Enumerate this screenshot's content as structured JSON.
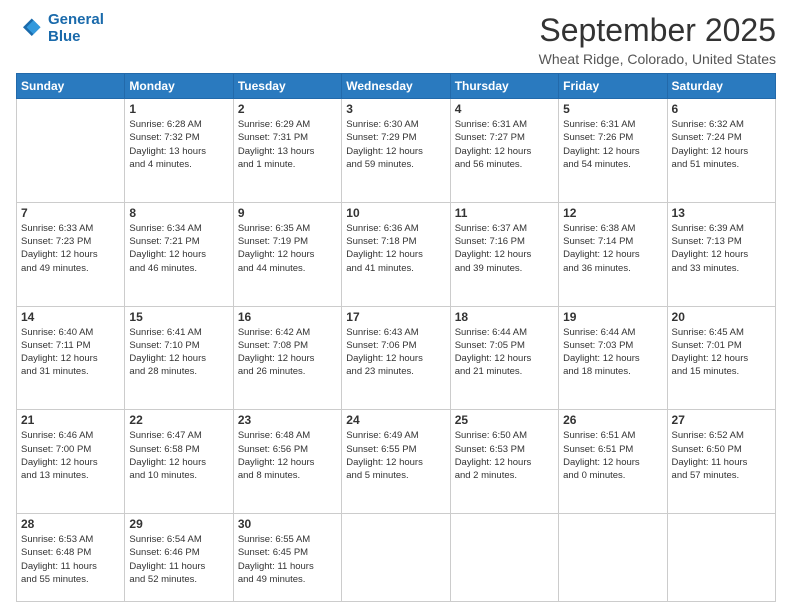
{
  "header": {
    "logo_line1": "General",
    "logo_line2": "Blue",
    "month_title": "September 2025",
    "location": "Wheat Ridge, Colorado, United States"
  },
  "days_of_week": [
    "Sunday",
    "Monday",
    "Tuesday",
    "Wednesday",
    "Thursday",
    "Friday",
    "Saturday"
  ],
  "weeks": [
    [
      {
        "day": "",
        "info": ""
      },
      {
        "day": "1",
        "info": "Sunrise: 6:28 AM\nSunset: 7:32 PM\nDaylight: 13 hours\nand 4 minutes."
      },
      {
        "day": "2",
        "info": "Sunrise: 6:29 AM\nSunset: 7:31 PM\nDaylight: 13 hours\nand 1 minute."
      },
      {
        "day": "3",
        "info": "Sunrise: 6:30 AM\nSunset: 7:29 PM\nDaylight: 12 hours\nand 59 minutes."
      },
      {
        "day": "4",
        "info": "Sunrise: 6:31 AM\nSunset: 7:27 PM\nDaylight: 12 hours\nand 56 minutes."
      },
      {
        "day": "5",
        "info": "Sunrise: 6:31 AM\nSunset: 7:26 PM\nDaylight: 12 hours\nand 54 minutes."
      },
      {
        "day": "6",
        "info": "Sunrise: 6:32 AM\nSunset: 7:24 PM\nDaylight: 12 hours\nand 51 minutes."
      }
    ],
    [
      {
        "day": "7",
        "info": "Sunrise: 6:33 AM\nSunset: 7:23 PM\nDaylight: 12 hours\nand 49 minutes."
      },
      {
        "day": "8",
        "info": "Sunrise: 6:34 AM\nSunset: 7:21 PM\nDaylight: 12 hours\nand 46 minutes."
      },
      {
        "day": "9",
        "info": "Sunrise: 6:35 AM\nSunset: 7:19 PM\nDaylight: 12 hours\nand 44 minutes."
      },
      {
        "day": "10",
        "info": "Sunrise: 6:36 AM\nSunset: 7:18 PM\nDaylight: 12 hours\nand 41 minutes."
      },
      {
        "day": "11",
        "info": "Sunrise: 6:37 AM\nSunset: 7:16 PM\nDaylight: 12 hours\nand 39 minutes."
      },
      {
        "day": "12",
        "info": "Sunrise: 6:38 AM\nSunset: 7:14 PM\nDaylight: 12 hours\nand 36 minutes."
      },
      {
        "day": "13",
        "info": "Sunrise: 6:39 AM\nSunset: 7:13 PM\nDaylight: 12 hours\nand 33 minutes."
      }
    ],
    [
      {
        "day": "14",
        "info": "Sunrise: 6:40 AM\nSunset: 7:11 PM\nDaylight: 12 hours\nand 31 minutes."
      },
      {
        "day": "15",
        "info": "Sunrise: 6:41 AM\nSunset: 7:10 PM\nDaylight: 12 hours\nand 28 minutes."
      },
      {
        "day": "16",
        "info": "Sunrise: 6:42 AM\nSunset: 7:08 PM\nDaylight: 12 hours\nand 26 minutes."
      },
      {
        "day": "17",
        "info": "Sunrise: 6:43 AM\nSunset: 7:06 PM\nDaylight: 12 hours\nand 23 minutes."
      },
      {
        "day": "18",
        "info": "Sunrise: 6:44 AM\nSunset: 7:05 PM\nDaylight: 12 hours\nand 21 minutes."
      },
      {
        "day": "19",
        "info": "Sunrise: 6:44 AM\nSunset: 7:03 PM\nDaylight: 12 hours\nand 18 minutes."
      },
      {
        "day": "20",
        "info": "Sunrise: 6:45 AM\nSunset: 7:01 PM\nDaylight: 12 hours\nand 15 minutes."
      }
    ],
    [
      {
        "day": "21",
        "info": "Sunrise: 6:46 AM\nSunset: 7:00 PM\nDaylight: 12 hours\nand 13 minutes."
      },
      {
        "day": "22",
        "info": "Sunrise: 6:47 AM\nSunset: 6:58 PM\nDaylight: 12 hours\nand 10 minutes."
      },
      {
        "day": "23",
        "info": "Sunrise: 6:48 AM\nSunset: 6:56 PM\nDaylight: 12 hours\nand 8 minutes."
      },
      {
        "day": "24",
        "info": "Sunrise: 6:49 AM\nSunset: 6:55 PM\nDaylight: 12 hours\nand 5 minutes."
      },
      {
        "day": "25",
        "info": "Sunrise: 6:50 AM\nSunset: 6:53 PM\nDaylight: 12 hours\nand 2 minutes."
      },
      {
        "day": "26",
        "info": "Sunrise: 6:51 AM\nSunset: 6:51 PM\nDaylight: 12 hours\nand 0 minutes."
      },
      {
        "day": "27",
        "info": "Sunrise: 6:52 AM\nSunset: 6:50 PM\nDaylight: 11 hours\nand 57 minutes."
      }
    ],
    [
      {
        "day": "28",
        "info": "Sunrise: 6:53 AM\nSunset: 6:48 PM\nDaylight: 11 hours\nand 55 minutes."
      },
      {
        "day": "29",
        "info": "Sunrise: 6:54 AM\nSunset: 6:46 PM\nDaylight: 11 hours\nand 52 minutes."
      },
      {
        "day": "30",
        "info": "Sunrise: 6:55 AM\nSunset: 6:45 PM\nDaylight: 11 hours\nand 49 minutes."
      },
      {
        "day": "",
        "info": ""
      },
      {
        "day": "",
        "info": ""
      },
      {
        "day": "",
        "info": ""
      },
      {
        "day": "",
        "info": ""
      }
    ]
  ]
}
